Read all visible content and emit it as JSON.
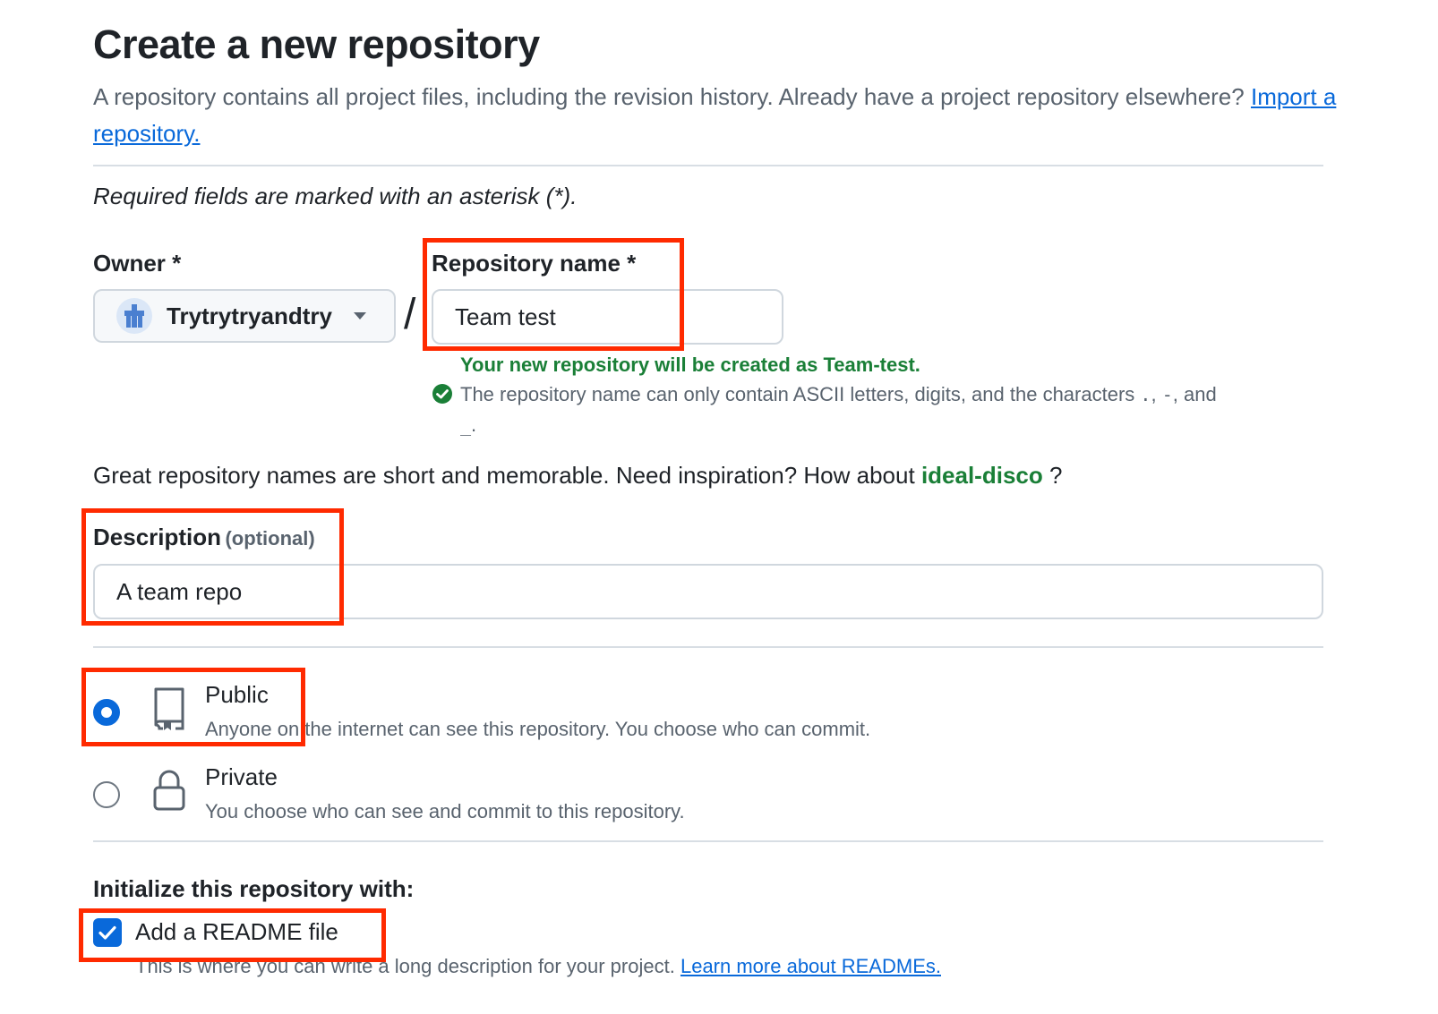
{
  "page": {
    "title": "Create a new repository",
    "subtitle": "A repository contains all project files, including the revision history. Already have a project repository elsewhere?",
    "import_link": "Import a repository.",
    "required_note": "Required fields are marked with an asterisk (*)."
  },
  "owner": {
    "label": "Owner *",
    "value": "Trytrytryandtry"
  },
  "repository": {
    "label": "Repository name *",
    "value": "Team test",
    "separator": "/",
    "success_message": "Your new repository will be created as Team-test.",
    "hint_prefix": "The repository name can only contain ASCII letters, digits, and the characters",
    "hint_chars_1": ".",
    "hint_sep_1": ",",
    "hint_chars_2": "-",
    "hint_sep_2": ", and",
    "hint_chars_3": "_",
    "hint_end": "."
  },
  "inspiration": {
    "text": "Great repository names are short and memorable. Need inspiration? How about",
    "suggestion": "ideal-disco",
    "end": "?"
  },
  "description": {
    "label": "Description",
    "optional": "(optional)",
    "value": "A team repo"
  },
  "visibility": {
    "selected": "public",
    "public_title": "Public",
    "public_desc": "Anyone on the internet can see this repository. You choose who can commit.",
    "private_title": "Private",
    "private_desc": "You choose who can see and commit to this repository."
  },
  "initialize": {
    "heading": "Initialize this repository with:",
    "readme_label": "Add a README file",
    "readme_checked": true,
    "readme_desc": "This is where you can write a long description for your project.",
    "readme_link": "Learn more about READMEs."
  },
  "colors": {
    "accent": "#0969da",
    "success": "#1a7f37",
    "highlight": "#ff2a00"
  }
}
